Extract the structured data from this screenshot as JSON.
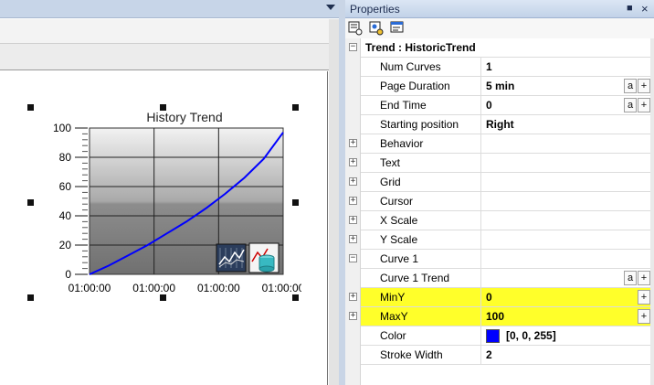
{
  "properties_panel": {
    "title": "Properties",
    "pin_glyph": "■",
    "close_glyph": "×",
    "toolbar": [
      "categorized-icon",
      "alphabetical-icon",
      "property-pages-icon"
    ],
    "section": {
      "label": "Trend : HistoricTrend",
      "expander": "−"
    },
    "rows": [
      {
        "name": "Num Curves",
        "value": "1"
      },
      {
        "name": "Page Duration",
        "value": "5 min",
        "btn_a": "a",
        "btn_plus": "+"
      },
      {
        "name": "End Time",
        "value": "0",
        "btn_a": "a",
        "btn_plus": "+"
      },
      {
        "name": "Starting position",
        "value": "Right"
      }
    ],
    "groups": [
      {
        "label": "Behavior",
        "expander": "+"
      },
      {
        "label": "Text",
        "expander": "+"
      },
      {
        "label": "Grid",
        "expander": "+"
      },
      {
        "label": "Cursor",
        "expander": "+"
      },
      {
        "label": "X Scale",
        "expander": "+"
      },
      {
        "label": "Y Scale",
        "expander": "+"
      }
    ],
    "curve_group": {
      "label": "Curve 1",
      "expander": "−"
    },
    "curve_rows": {
      "trend": {
        "name": "Curve 1 Trend",
        "value": "",
        "btn_a": "a",
        "btn_plus": "+"
      },
      "miny": {
        "name": "MinY",
        "value": "0",
        "btn_plus": "+",
        "expander": "+"
      },
      "maxy": {
        "name": "MaxY",
        "value": "100",
        "btn_plus": "+",
        "expander": "+"
      },
      "color": {
        "name": "Color",
        "value": "[0, 0, 255]",
        "swatch": "#0000ff"
      },
      "stroke": {
        "name": "Stroke Width",
        "value": "2"
      }
    }
  },
  "trend_widget": {
    "title": "History Trend",
    "curve_color": "#0000ff",
    "chart_data": {
      "type": "line",
      "title": "History Trend",
      "y_ticks": [
        0,
        20,
        40,
        60,
        80,
        100
      ],
      "x_ticks": [
        "01:00:00",
        "01:00:00",
        "01:00:00",
        "01:00:00"
      ],
      "ylim": [
        0,
        100
      ],
      "xlim": [
        0,
        1
      ],
      "series": [
        {
          "x": [
            0,
            0.1,
            0.2,
            0.3,
            0.4,
            0.5,
            0.6,
            0.7,
            0.8,
            0.9,
            1.0
          ],
          "y": [
            0,
            6,
            13,
            20,
            28,
            36,
            45,
            55,
            66,
            79,
            97
          ]
        }
      ]
    },
    "overlay_icons": [
      "trend-chart-icon",
      "database-icon"
    ]
  }
}
